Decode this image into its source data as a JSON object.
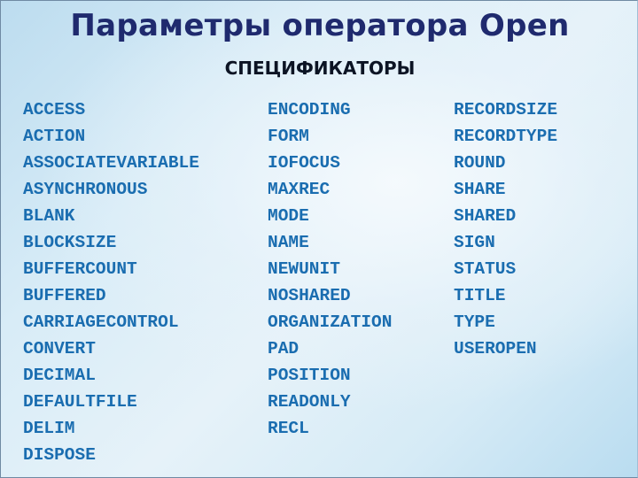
{
  "slide": {
    "title": "Параметры оператора Open",
    "subtitle": "СПЕЦИФИКАТОРЫ",
    "columns": [
      {
        "items": [
          "ACCESS",
          "ACTION",
          "ASSOCIATEVARIABLE",
          "ASYNCHRONOUS",
          "BLANK",
          "BLOCKSIZE",
          "BUFFERCOUNT",
          "BUFFERED",
          "CARRIAGECONTROL",
          "CONVERT",
          "DECIMAL",
          "DEFAULTFILE",
          "DELIM",
          "DISPOSE"
        ]
      },
      {
        "items": [
          "ENCODING",
          "FORM",
          "IOFOCUS",
          "MAXREC",
          "MODE",
          "NAME",
          "NEWUNIT",
          "NOSHARED",
          "ORGANIZATION",
          "PAD",
          "POSITION",
          "READONLY",
          "RECL"
        ]
      },
      {
        "items": [
          "RECORDSIZE",
          "RECORDTYPE",
          "ROUND",
          "SHARE",
          "SHARED",
          "SIGN",
          "STATUS",
          "TITLE",
          "TYPE",
          "USEROPEN"
        ]
      }
    ]
  },
  "colors": {
    "title": "#1f2a6e",
    "subtitle": "#0c1424",
    "list_text": "#1a6db0",
    "background_light": "#e6f2f9",
    "background_dark": "#bcdcef"
  }
}
